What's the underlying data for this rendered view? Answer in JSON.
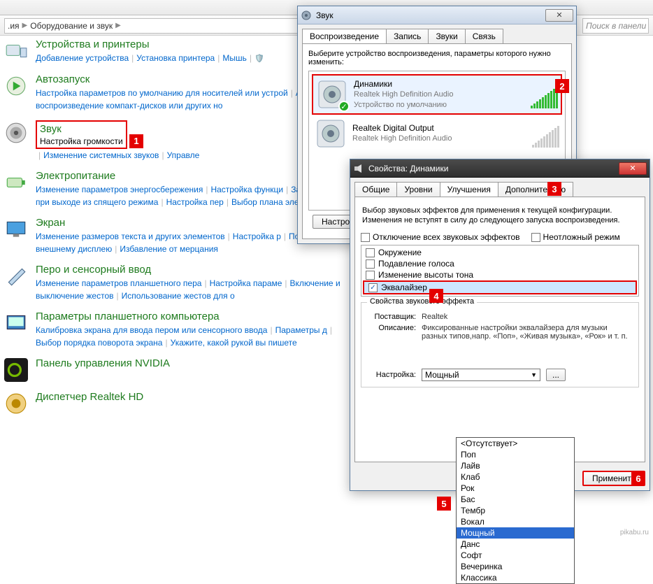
{
  "breadcrumb": {
    "sep": ".ия",
    "item": "Оборудование и звук"
  },
  "search_placeholder": "Поиск в панели у",
  "categories": [
    {
      "id": "devices",
      "title": "Устройства и принтеры",
      "links": [
        "Добавление устройства",
        "Установка принтера",
        "Мышь"
      ],
      "shield": true
    },
    {
      "id": "autoplay",
      "title": "Автозапуск",
      "links": [
        "Настройка параметров по умолчанию для носителей или устрой",
        "Автоматическое воспроизведение компакт-дисков или других но"
      ]
    },
    {
      "id": "sound",
      "title": "Звук",
      "links": [
        "Настройка громкости",
        "Изменение системных звуков",
        "Управле"
      ],
      "call": 1
    },
    {
      "id": "power",
      "title": "Электропитание",
      "links": [
        "Изменение параметров энергосбережения",
        "Настройка функци",
        "Запрос пароля при выходе из спящего режима",
        "Настройка пер",
        "Выбор плана электропитания"
      ]
    },
    {
      "id": "display",
      "title": "Экран",
      "links": [
        "Изменение размеров текста и других элементов",
        "Настройка р",
        "Подключение к внешнему дисплею",
        "Избавление от мерцания"
      ]
    },
    {
      "id": "pen",
      "title": "Перо и сенсорный ввод",
      "links": [
        "Изменение параметров планшетного пера",
        "Настройка параме",
        "Включение и выключение жестов",
        "Использование жестов для о"
      ]
    },
    {
      "id": "tablet",
      "title": "Параметры планшетного компьютера",
      "links": [
        "Калибровка экрана для ввода пером или сенсорного ввода",
        "Параметры д",
        "Выбор порядка поворота экрана",
        "Укажите, какой рукой вы пишете"
      ]
    },
    {
      "id": "nvidia",
      "title": "Панель управления NVIDIA",
      "links": []
    },
    {
      "id": "realtek",
      "title": "Диспетчер Realtek HD",
      "links": []
    }
  ],
  "soundDlg": {
    "title": "Звук",
    "tabs": [
      "Воспроизведение",
      "Запись",
      "Звуки",
      "Связь"
    ],
    "activeTab": 0,
    "prompt": "Выберите устройство воспроизведения, параметры которого нужно изменить:",
    "devices": [
      {
        "name": "Динамики",
        "sub1": "Realtek High Definition Audio",
        "sub2": "Устройство по умолчанию",
        "level": 10,
        "default": true
      },
      {
        "name": "Realtek Digital Output",
        "sub1": "Realtek High Definition Audio",
        "sub2": "",
        "level": 0,
        "default": false
      }
    ],
    "btn_settings": "Настро...",
    "call": 2
  },
  "propsDlg": {
    "title": "Свойства: Динамики",
    "tabs": [
      "Общие",
      "Уровни",
      "Улучшения",
      "Дополнительно"
    ],
    "activeTab": 2,
    "call_tab": 3,
    "desc": "Выбор звуковых эффектов для применения к текущей конфигурации. Изменения не вступят в силу до следующего запуска воспроизведения.",
    "chk_disable": "Отключение всех звуковых эффектов",
    "chk_urgent": "Неотложный режим",
    "fx": [
      {
        "label": "Окружение",
        "checked": false
      },
      {
        "label": "Подавление голоса",
        "checked": false
      },
      {
        "label": "Изменение высоты тона",
        "checked": false
      },
      {
        "label": "Эквалайзер",
        "checked": true,
        "call": 4
      }
    ],
    "group_title": "Свойства звукового эффекта",
    "kv": [
      {
        "k": "Поставщик:",
        "v": "Realtek"
      },
      {
        "k": "Описание:",
        "v": "Фиксированные настройки эквалайзера для музыки разных типов,напр. «Поп», «Живая музыка», «Рок» и т. п."
      }
    ],
    "preset_label": "Настройка:",
    "preset_value": "Мощный",
    "more_btn": "...",
    "dropdown": [
      "<Отсутствует>",
      "Поп",
      "Лайв",
      "Клаб",
      "Рок",
      "Бас",
      "Тембр",
      "Вокал",
      "Мощный",
      "Данс",
      "Софт",
      "Вечеринка",
      "Классика"
    ],
    "dropdown_sel": "Мощный",
    "call_dd": 5,
    "btn_apply": "Применить",
    "call_apply": 6
  },
  "watermark": "pikabu.ru"
}
